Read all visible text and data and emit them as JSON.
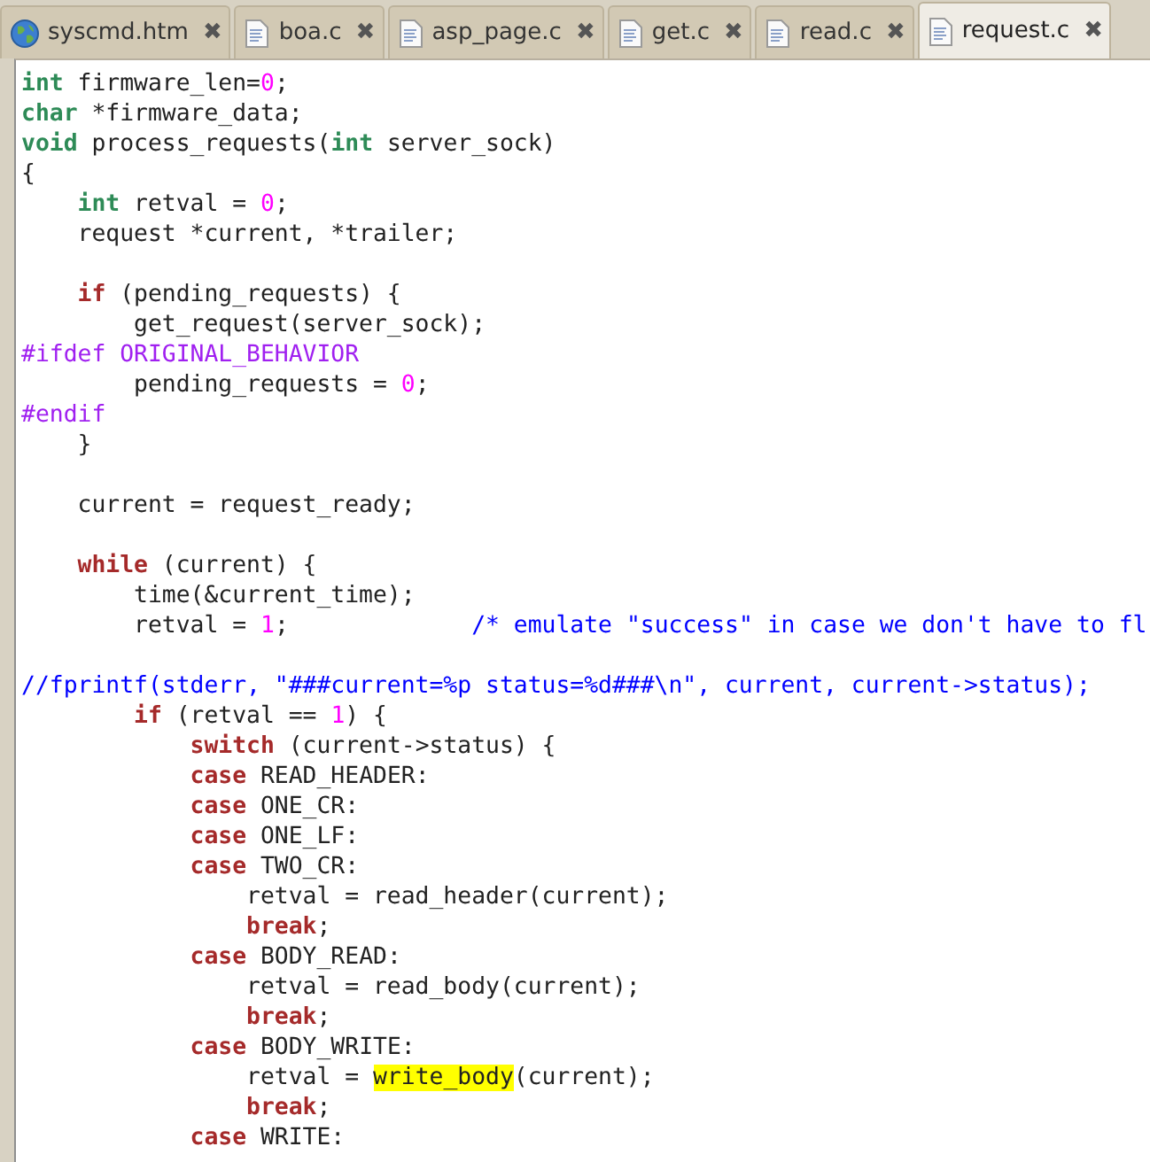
{
  "tabs": [
    {
      "label": "syscmd.htm",
      "kind": "webpage",
      "selected": false
    },
    {
      "label": "boa.c",
      "kind": "source",
      "selected": false
    },
    {
      "label": "asp_page.c",
      "kind": "source",
      "selected": false
    },
    {
      "label": "get.c",
      "kind": "source",
      "selected": false
    },
    {
      "label": "read.c",
      "kind": "source",
      "selected": false
    },
    {
      "label": "request.c",
      "kind": "source",
      "selected": true
    }
  ],
  "close_symbol": "✖",
  "code_lines": [
    {
      "kind": "code",
      "tokens": [
        {
          "kind": "type",
          "text": "int"
        },
        {
          "kind": "plain",
          "text": " firmware_len="
        },
        {
          "kind": "number",
          "text": "0"
        },
        {
          "kind": "plain",
          "text": ";"
        }
      ]
    },
    {
      "kind": "code",
      "tokens": [
        {
          "kind": "type",
          "text": "char"
        },
        {
          "kind": "plain",
          "text": " *firmware_data;"
        }
      ]
    },
    {
      "kind": "code",
      "tokens": [
        {
          "kind": "type",
          "text": "void"
        },
        {
          "kind": "plain",
          "text": " process_requests("
        },
        {
          "kind": "type",
          "text": "int"
        },
        {
          "kind": "plain",
          "text": " server_sock)"
        }
      ]
    },
    {
      "kind": "code",
      "tokens": [
        {
          "kind": "plain",
          "text": "{"
        }
      ]
    },
    {
      "kind": "code",
      "tokens": [
        {
          "kind": "type",
          "text": "    int"
        },
        {
          "kind": "plain",
          "text": " retval = "
        },
        {
          "kind": "number",
          "text": "0"
        },
        {
          "kind": "plain",
          "text": ";"
        }
      ]
    },
    {
      "kind": "code",
      "tokens": [
        {
          "kind": "plain",
          "text": "    request *current, *trailer;"
        }
      ]
    },
    {
      "kind": "blank"
    },
    {
      "kind": "code",
      "tokens": [
        {
          "kind": "keyword",
          "text": "    if"
        },
        {
          "kind": "plain",
          "text": " (pending_requests) {"
        }
      ]
    },
    {
      "kind": "code",
      "tokens": [
        {
          "kind": "plain",
          "text": "        get_request(server_sock);"
        }
      ]
    },
    {
      "kind": "code",
      "tokens": [
        {
          "kind": "preprocessor",
          "text": "#ifdef ORIGINAL_BEHAVIOR"
        }
      ]
    },
    {
      "kind": "code",
      "tokens": [
        {
          "kind": "plain",
          "text": "        pending_requests = "
        },
        {
          "kind": "number",
          "text": "0"
        },
        {
          "kind": "plain",
          "text": ";"
        }
      ]
    },
    {
      "kind": "code",
      "tokens": [
        {
          "kind": "preprocessor",
          "text": "#endif"
        }
      ]
    },
    {
      "kind": "code",
      "tokens": [
        {
          "kind": "plain",
          "text": "    }"
        }
      ]
    },
    {
      "kind": "blank"
    },
    {
      "kind": "code",
      "tokens": [
        {
          "kind": "plain",
          "text": "    current = request_ready;"
        }
      ]
    },
    {
      "kind": "blank"
    },
    {
      "kind": "code",
      "tokens": [
        {
          "kind": "keyword",
          "text": "    while"
        },
        {
          "kind": "plain",
          "text": " (current) {"
        }
      ]
    },
    {
      "kind": "code",
      "tokens": [
        {
          "kind": "plain",
          "text": "        time(&current_time);"
        }
      ]
    },
    {
      "kind": "code",
      "tokens": [
        {
          "kind": "plain",
          "text": "        retval = "
        },
        {
          "kind": "number",
          "text": "1"
        },
        {
          "kind": "plain",
          "text": ";"
        },
        {
          "kind": "comment",
          "text": "             /* emulate \"success\" in case we don't have to fl"
        }
      ]
    },
    {
      "kind": "blank"
    },
    {
      "kind": "code",
      "tokens": [
        {
          "kind": "comment",
          "text": "//fprintf(stderr, \"###current=%p status=%d###\\n\", current, current->status);"
        }
      ]
    },
    {
      "kind": "code",
      "tokens": [
        {
          "kind": "keyword",
          "text": "        if"
        },
        {
          "kind": "plain",
          "text": " (retval == "
        },
        {
          "kind": "number",
          "text": "1"
        },
        {
          "kind": "plain",
          "text": ") {"
        }
      ]
    },
    {
      "kind": "code",
      "tokens": [
        {
          "kind": "keyword",
          "text": "            switch"
        },
        {
          "kind": "plain",
          "text": " (current->status) {"
        }
      ]
    },
    {
      "kind": "code",
      "tokens": [
        {
          "kind": "keyword",
          "text": "            case"
        },
        {
          "kind": "plain",
          "text": " READ_HEADER:"
        }
      ]
    },
    {
      "kind": "code",
      "tokens": [
        {
          "kind": "keyword",
          "text": "            case"
        },
        {
          "kind": "plain",
          "text": " ONE_CR:"
        }
      ]
    },
    {
      "kind": "code",
      "tokens": [
        {
          "kind": "keyword",
          "text": "            case"
        },
        {
          "kind": "plain",
          "text": " ONE_LF:"
        }
      ]
    },
    {
      "kind": "code",
      "tokens": [
        {
          "kind": "keyword",
          "text": "            case"
        },
        {
          "kind": "plain",
          "text": " TWO_CR:"
        }
      ]
    },
    {
      "kind": "code",
      "tokens": [
        {
          "kind": "plain",
          "text": "                retval = read_header(current);"
        }
      ]
    },
    {
      "kind": "code",
      "tokens": [
        {
          "kind": "keyword",
          "text": "                break"
        },
        {
          "kind": "plain",
          "text": ";"
        }
      ]
    },
    {
      "kind": "code",
      "tokens": [
        {
          "kind": "keyword",
          "text": "            case"
        },
        {
          "kind": "plain",
          "text": " BODY_READ:"
        }
      ]
    },
    {
      "kind": "code",
      "tokens": [
        {
          "kind": "plain",
          "text": "                retval = read_body(current);"
        }
      ]
    },
    {
      "kind": "code",
      "tokens": [
        {
          "kind": "keyword",
          "text": "                break"
        },
        {
          "kind": "plain",
          "text": ";"
        }
      ]
    },
    {
      "kind": "code",
      "tokens": [
        {
          "kind": "keyword",
          "text": "            case"
        },
        {
          "kind": "plain",
          "text": " BODY_WRITE:"
        }
      ]
    },
    {
      "kind": "code",
      "tokens": [
        {
          "kind": "plain",
          "text": "                retval = "
        },
        {
          "kind": "highlight",
          "text": "write_body"
        },
        {
          "kind": "plain",
          "text": "(current);"
        }
      ]
    },
    {
      "kind": "code",
      "tokens": [
        {
          "kind": "keyword",
          "text": "                break"
        },
        {
          "kind": "plain",
          "text": ";"
        }
      ]
    },
    {
      "kind": "code",
      "tokens": [
        {
          "kind": "keyword",
          "text": "            case"
        },
        {
          "kind": "plain",
          "text": " WRITE:"
        }
      ]
    }
  ]
}
